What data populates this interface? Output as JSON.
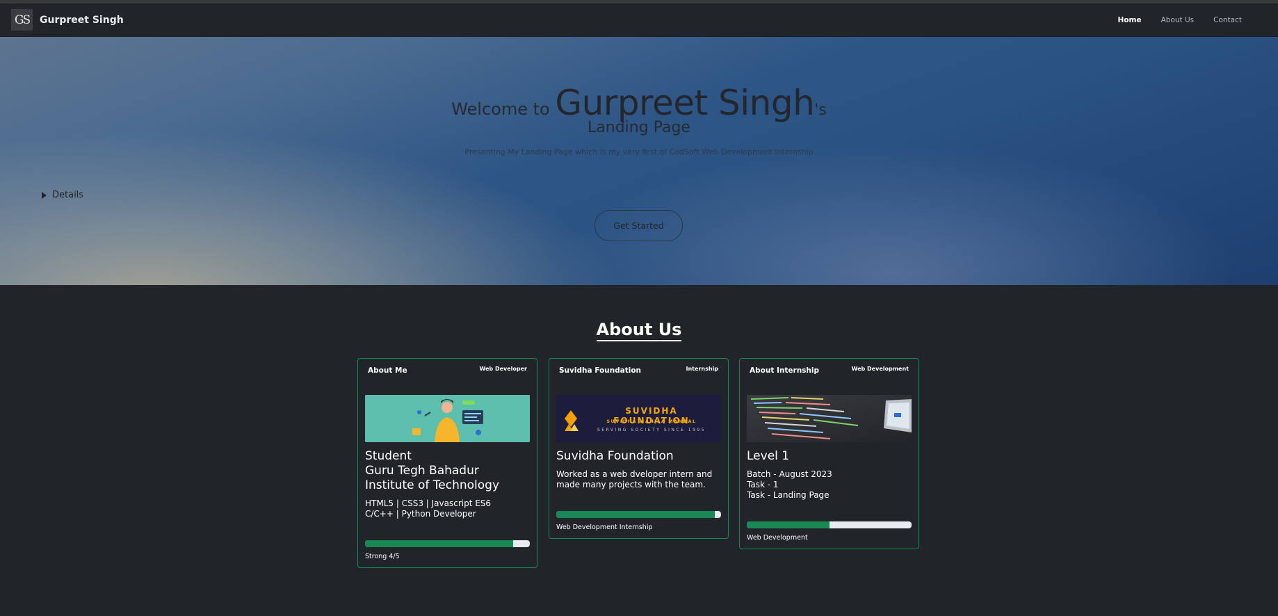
{
  "nav": {
    "logo_text": "GS",
    "brand": "Gurpreet Singh",
    "links": [
      "Home",
      "About Us",
      "Contact"
    ],
    "active": "Home"
  },
  "hero": {
    "welcome": "Welcome to ",
    "name": "Gurpreet Singh",
    "possessive": "'s",
    "line2": "Landing Page",
    "subtitle": "Presenting My Landing Page which is my very first of CodSoft Web Development Internship",
    "details": "Details",
    "cta": "Get Started"
  },
  "about": {
    "title": "About Us",
    "cards": [
      {
        "header": "About Me",
        "badge": "Web Developer",
        "image": "developer-illustration",
        "title_lines": [
          "Student",
          "Guru Tegh Bahadur Institute of Technology"
        ],
        "text_lines": [
          "HTML5 | CSS3 | Javascript ES6",
          "C/C++ | Python Developer"
        ],
        "progress": 0.9,
        "footer": "Strong 4/5"
      },
      {
        "header": "Suvidha Foundation",
        "badge": "Internship",
        "image": "suvidha-foundation-banner",
        "image_text": [
          "SUVIDHA FOUNDATION",
          "SUVIDHA MAHILA MANDAL",
          "SERVING SOCIETY SINCE 1995"
        ],
        "title_lines": [
          "Suvidha Foundation"
        ],
        "text_lines": [
          "Worked as a web dveloper intern and made many projects with the team."
        ],
        "progress": 0.96,
        "footer": "Web Development Internship"
      },
      {
        "header": "About Internship",
        "badge": "Web Development",
        "image": "code-on-screen-photo",
        "title_lines": [
          "Level 1"
        ],
        "text_lines": [
          "Batch - August 2023",
          "Task - 1",
          "Task - Landing Page"
        ],
        "progress": 0.5,
        "footer": "Web Development"
      }
    ]
  },
  "colors": {
    "accent_green": "#198754",
    "navbar_bg": "#212529",
    "page_bg": "#212529"
  }
}
